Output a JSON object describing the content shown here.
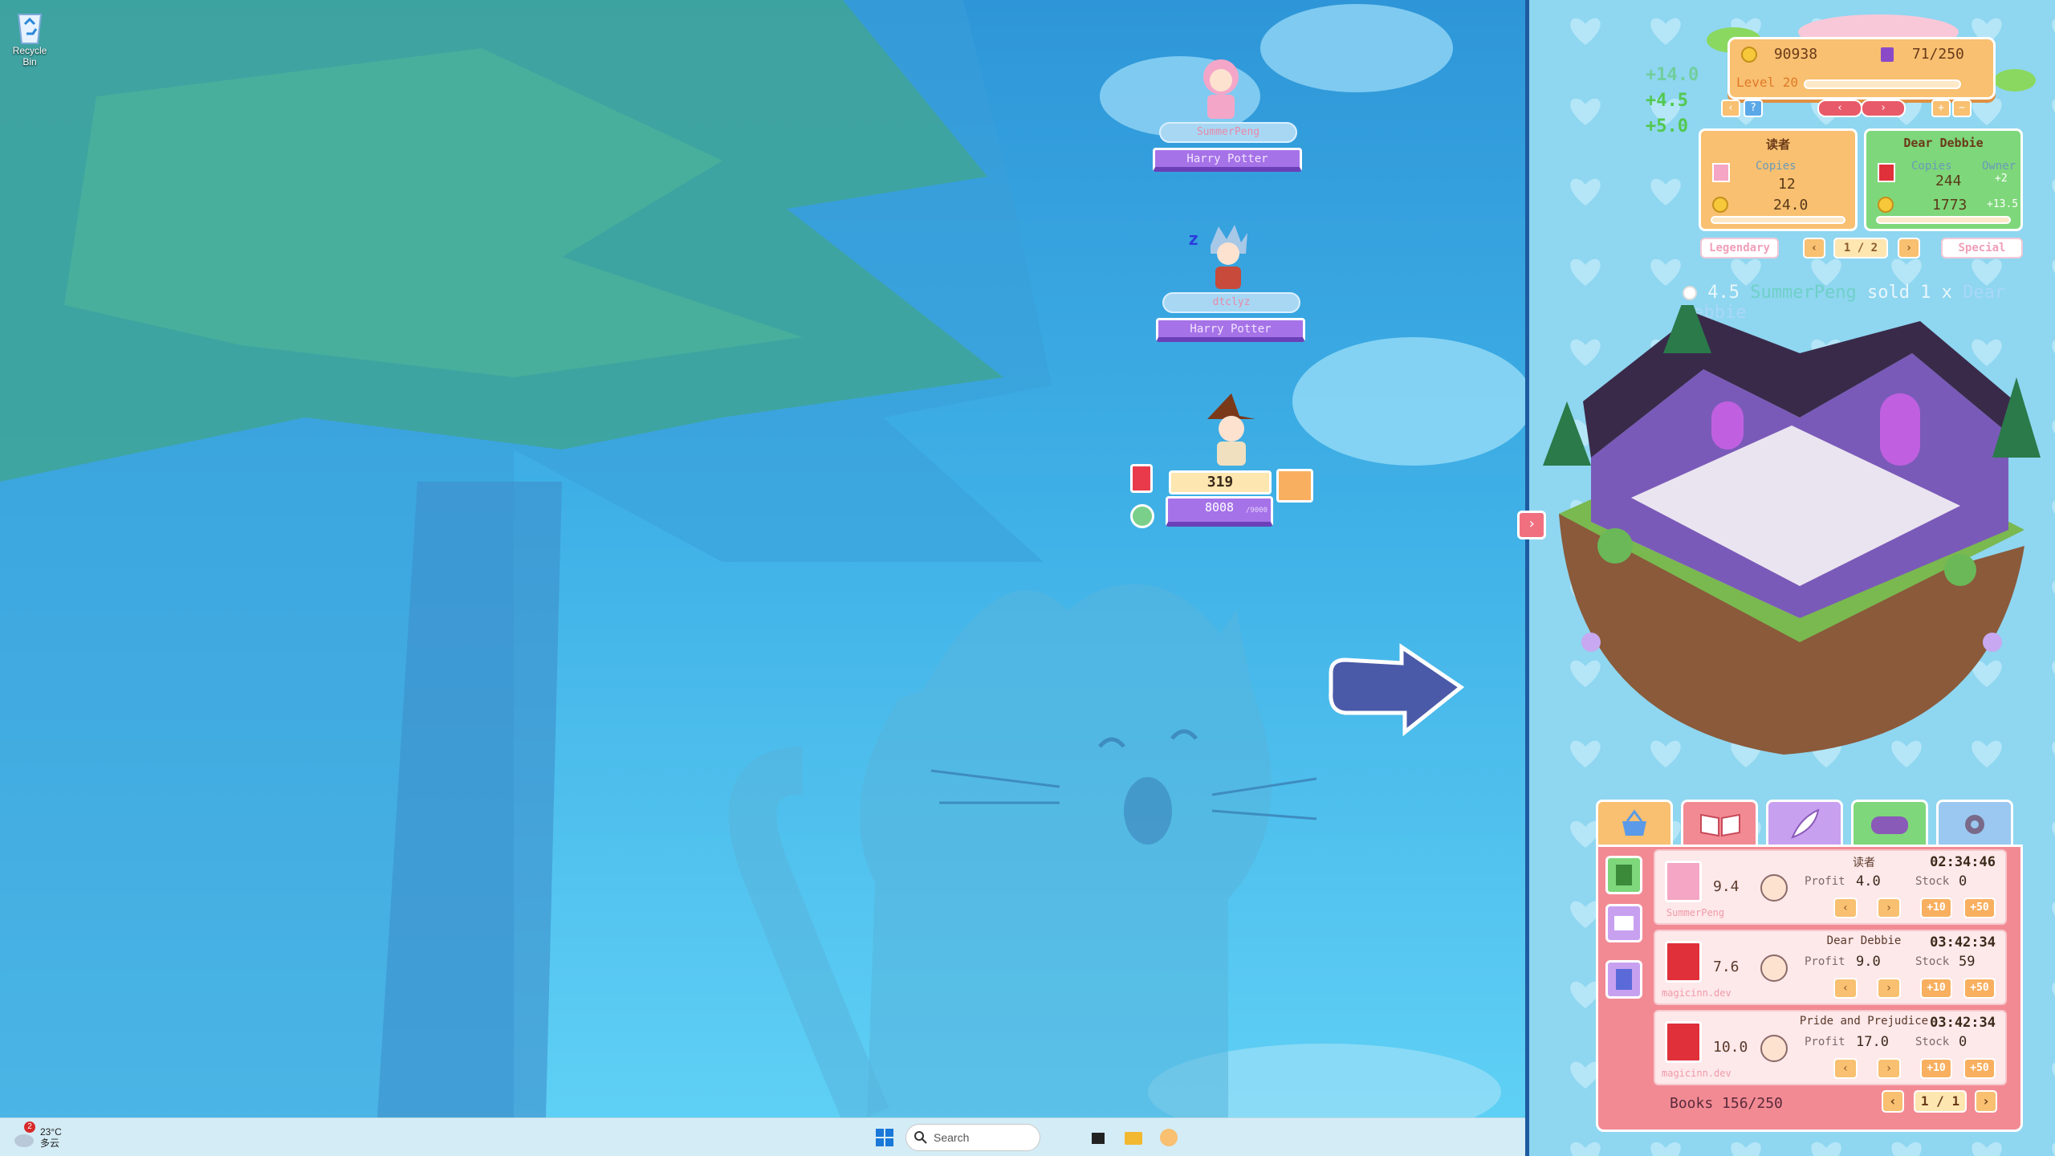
{
  "desktop": {
    "recycle_bin_label": "Recycle Bin",
    "players": [
      {
        "name": "SummerPeng",
        "book": "Harry Potter"
      },
      {
        "name": "dtclyz",
        "book": "Harry Potter"
      }
    ],
    "my_player": {
      "count": "319",
      "value": "8008",
      "sub": "/9000"
    },
    "sleep_glyph": "z"
  },
  "taskbar": {
    "weather_badge": "2",
    "weather_temp": "23°C",
    "weather_desc": "多云",
    "search_placeholder": "Search"
  },
  "game": {
    "coins": "90938",
    "books_capacity": "71/250",
    "level_label": "Level 20",
    "deltas": [
      "+14.0",
      "+4.5",
      "+5.0"
    ],
    "card_left": {
      "title": "读者",
      "copies_label": "Copies",
      "copies": "12",
      "income": "24.0"
    },
    "card_right": {
      "title": "Dear Debbie",
      "copies_label": "Copies",
      "copies": "244",
      "owner_label": "Owner",
      "owner_delta": "+2",
      "income": "1773",
      "income_delta": "+13.5"
    },
    "tier_left": "Legendary",
    "tier_right": "Special",
    "page": "1 / 2",
    "sold_amount": "4.5",
    "sold_user": "SummerPeng",
    "sold_text": "sold 1 x",
    "sold_book": "Dear Debbie",
    "shop_rows": [
      {
        "price": "9.4",
        "seller": "SummerPeng",
        "title": "读者",
        "time": "02:34:46",
        "profit_label": "Profit",
        "profit": "4.0",
        "stock_label": "Stock",
        "stock": "0",
        "btn10": "+10",
        "btn50": "+50",
        "book_color": "#f5a6c4"
      },
      {
        "price": "7.6",
        "seller": "magicinn.dev",
        "title": "Dear Debbie",
        "time": "03:42:34",
        "profit_label": "Profit",
        "profit": "9.0",
        "stock_label": "Stock",
        "stock": "59",
        "btn10": "+10",
        "btn50": "+50",
        "book_color": "#e0303a"
      },
      {
        "price": "10.0",
        "seller": "magicinn.dev",
        "title": "Pride and Prejudice",
        "time": "03:42:34",
        "profit_label": "Profit",
        "profit": "17.0",
        "stock_label": "Stock",
        "stock": "0",
        "btn10": "+10",
        "btn50": "+50",
        "book_color": "#e0303a"
      }
    ],
    "books_footer": "Books 156/250",
    "shop_page": "1 / 1",
    "colors": {
      "panel_bg": "#8fd6f0",
      "shop_bg": "#f28a94",
      "accent_orange": "#f8c070",
      "accent_purple": "#a672e8",
      "green_delta": "#52c84e"
    }
  }
}
